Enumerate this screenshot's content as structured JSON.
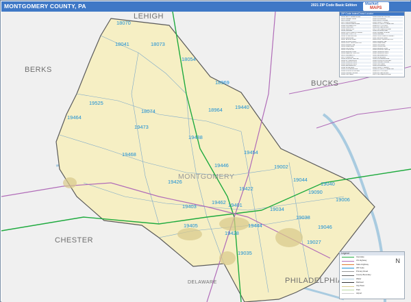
{
  "header": {
    "title": "MONTGOMERY COUNTY, PA",
    "edition": "2021 ZIP Code Basic Edition",
    "logo_text_1": "Market",
    "logo_text_2": "MAPS"
  },
  "map": {
    "regions": [
      "LEHIGH",
      "BERKS",
      "BUCKS",
      "CHESTER",
      "DELAWARE",
      "PHILADELPHIA"
    ],
    "county": "MONTGOMERY",
    "zip_codes": [
      "18070",
      "18041",
      "18073",
      "18054",
      "18969",
      "19525",
      "18074",
      "18964",
      "19440",
      "19464",
      "19473",
      "19438",
      "19446",
      "19454",
      "19468",
      "19002",
      "19426",
      "19422",
      "19044",
      "19040",
      "19090",
      "19006",
      "19403",
      "19462",
      "19401",
      "19034",
      "19038",
      "19405",
      "19046",
      "19428",
      "19444",
      "19027",
      "19035"
    ],
    "colors": {
      "county_fill": "#f6efc4",
      "outside_fill": "#f0f0f0",
      "zip_label": "#1a8fd6",
      "county_border": "#5a5a5a",
      "highway_purple": "#b06bb8",
      "highway_green": "#1eaa3e",
      "water": "#a9cbe0"
    }
  },
  "zip_table": {
    "title": "ZIP Code Index/Cross Locator",
    "rows_left": [
      "18041 EAST GREENVILLE",
      "18054 GREEN LANE",
      "18070 PALM",
      "18073 PENNSBURG",
      "18074 PERKIOMENVILLE",
      "18964 SOUDERTON",
      "18969 TELFORD",
      "19001 ABINGTON",
      "19002 AMBLER",
      "19006 HUNTINGDON VALLEY",
      "19009 BRYN ATHYN",
      "19012 CHELTENHAM",
      "19025 DRESHER",
      "19027 ELKINS PARK",
      "19031 FLOURTOWN",
      "19034 FORT WASHINGTON",
      "19035 GLADWYNE",
      "19038 GLENSIDE",
      "19040 HATBORO",
      "19044 HORSHAM",
      "19046 JENKINTOWN",
      "19066 MERION STATION",
      "19072 NARBERTH",
      "19075 ORELAND",
      "19090 WILLOW GROVE",
      "19096 WYNNEWOOD",
      "19401 NORRISTOWN",
      "19403 NORRISTOWN",
      "19405 BRIDGEPORT",
      "19422 BLUE BELL",
      "19426 COLLEGEVILLE",
      "19428 CONSHOHOCKEN",
      "19438 HARLEYSVILLE",
      "19440 HATFIELD"
    ],
    "rows_right": [
      "19444 LAFAYETTE HILL",
      "19446 LANSDALE",
      "19453 MONT CLARE",
      "19454 NORTH WALES",
      "19462 PLYMOUTH MEETING",
      "19464 POTTSTOWN",
      "19468 ROYERSFORD",
      "19473 SCHWENKSVILLE",
      "19490 WORCESTER",
      "19525 GILBERTSVILLE",
      "19002 AMBLER",
      "19006 HUNTINGDON VALLEY",
      "19027 ELKINS PARK",
      "19034 FORT WASHINGTON",
      "19035 GLADWYNE",
      "19038 GLENSIDE",
      "19040 HATBORO",
      "19044 HORSHAM",
      "19046 JENKINTOWN",
      "19090 WILLOW GROVE",
      "19401 NORRISTOWN",
      "19403 NORRISTOWN",
      "19405 BRIDGEPORT",
      "19422 BLUE BELL",
      "19426 COLLEGEVILLE",
      "19428 CONSHOHOCKEN",
      "19438 HARLEYSVILLE",
      "19440 HATFIELD",
      "19446 LANSDALE",
      "19454 NORTH WALES",
      "19462 PLYMOUTH MEETING",
      "19464 POTTSTOWN",
      "19468 ROYERSFORD",
      "19473 SCHWENKSVILLE"
    ]
  },
  "legend": {
    "title": "Legend",
    "items": [
      {
        "label": "Interstate",
        "color": "#1eaa3e"
      },
      {
        "label": "US Highway",
        "color": "#b06bb8"
      },
      {
        "label": "State Highway",
        "color": "#e07a2e"
      },
      {
        "label": "ZIP Code",
        "color": "#1a8fd6"
      },
      {
        "label": "Primary Road",
        "color": "#999999"
      },
      {
        "label": "County Boundary",
        "color": "#5a5a5a"
      },
      {
        "label": "Water",
        "color": "#a9cbe0"
      },
      {
        "label": "Railroad",
        "color": "#333333"
      },
      {
        "label": "City/Town",
        "color": "#d9c98a"
      },
      {
        "label": "Park",
        "color": "#b9d9a3"
      },
      {
        "label": "Airport",
        "color": "#cfcfcf"
      }
    ],
    "compass": "N"
  }
}
